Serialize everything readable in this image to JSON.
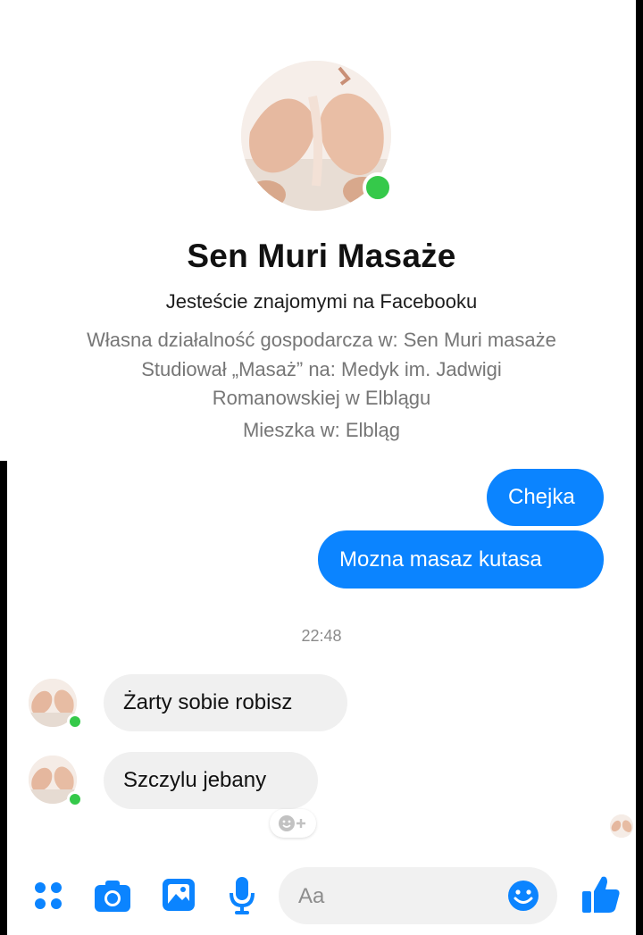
{
  "colors": {
    "accent": "#0b84ff",
    "online": "#35c94a",
    "incoming_bubble": "#f0f0f0"
  },
  "profile": {
    "name": "Sen Muri Masaże",
    "friendship": "Jesteście znajomymi na Facebooku",
    "work": "Własna działalność gospodarcza w: Sen Muri masaże",
    "education_line1": "Studiował „Masaż”  na: Medyk im. Jadwigi",
    "education_line2": "Romanowskiej w Elblągu",
    "location": "Mieszka w: Elbląg"
  },
  "messages": {
    "outgoing": [
      {
        "text": "Chejka"
      },
      {
        "text": "Mozna masaz kutasa"
      }
    ],
    "timestamp": "22:48",
    "incoming": [
      {
        "text": "Żarty sobie robisz"
      },
      {
        "text": "Szczylu  jebany"
      }
    ]
  },
  "composer": {
    "placeholder": "Aa",
    "icons": [
      "menu-dots-icon",
      "camera-icon",
      "gallery-icon",
      "microphone-icon",
      "emoji-icon",
      "like-icon"
    ]
  }
}
